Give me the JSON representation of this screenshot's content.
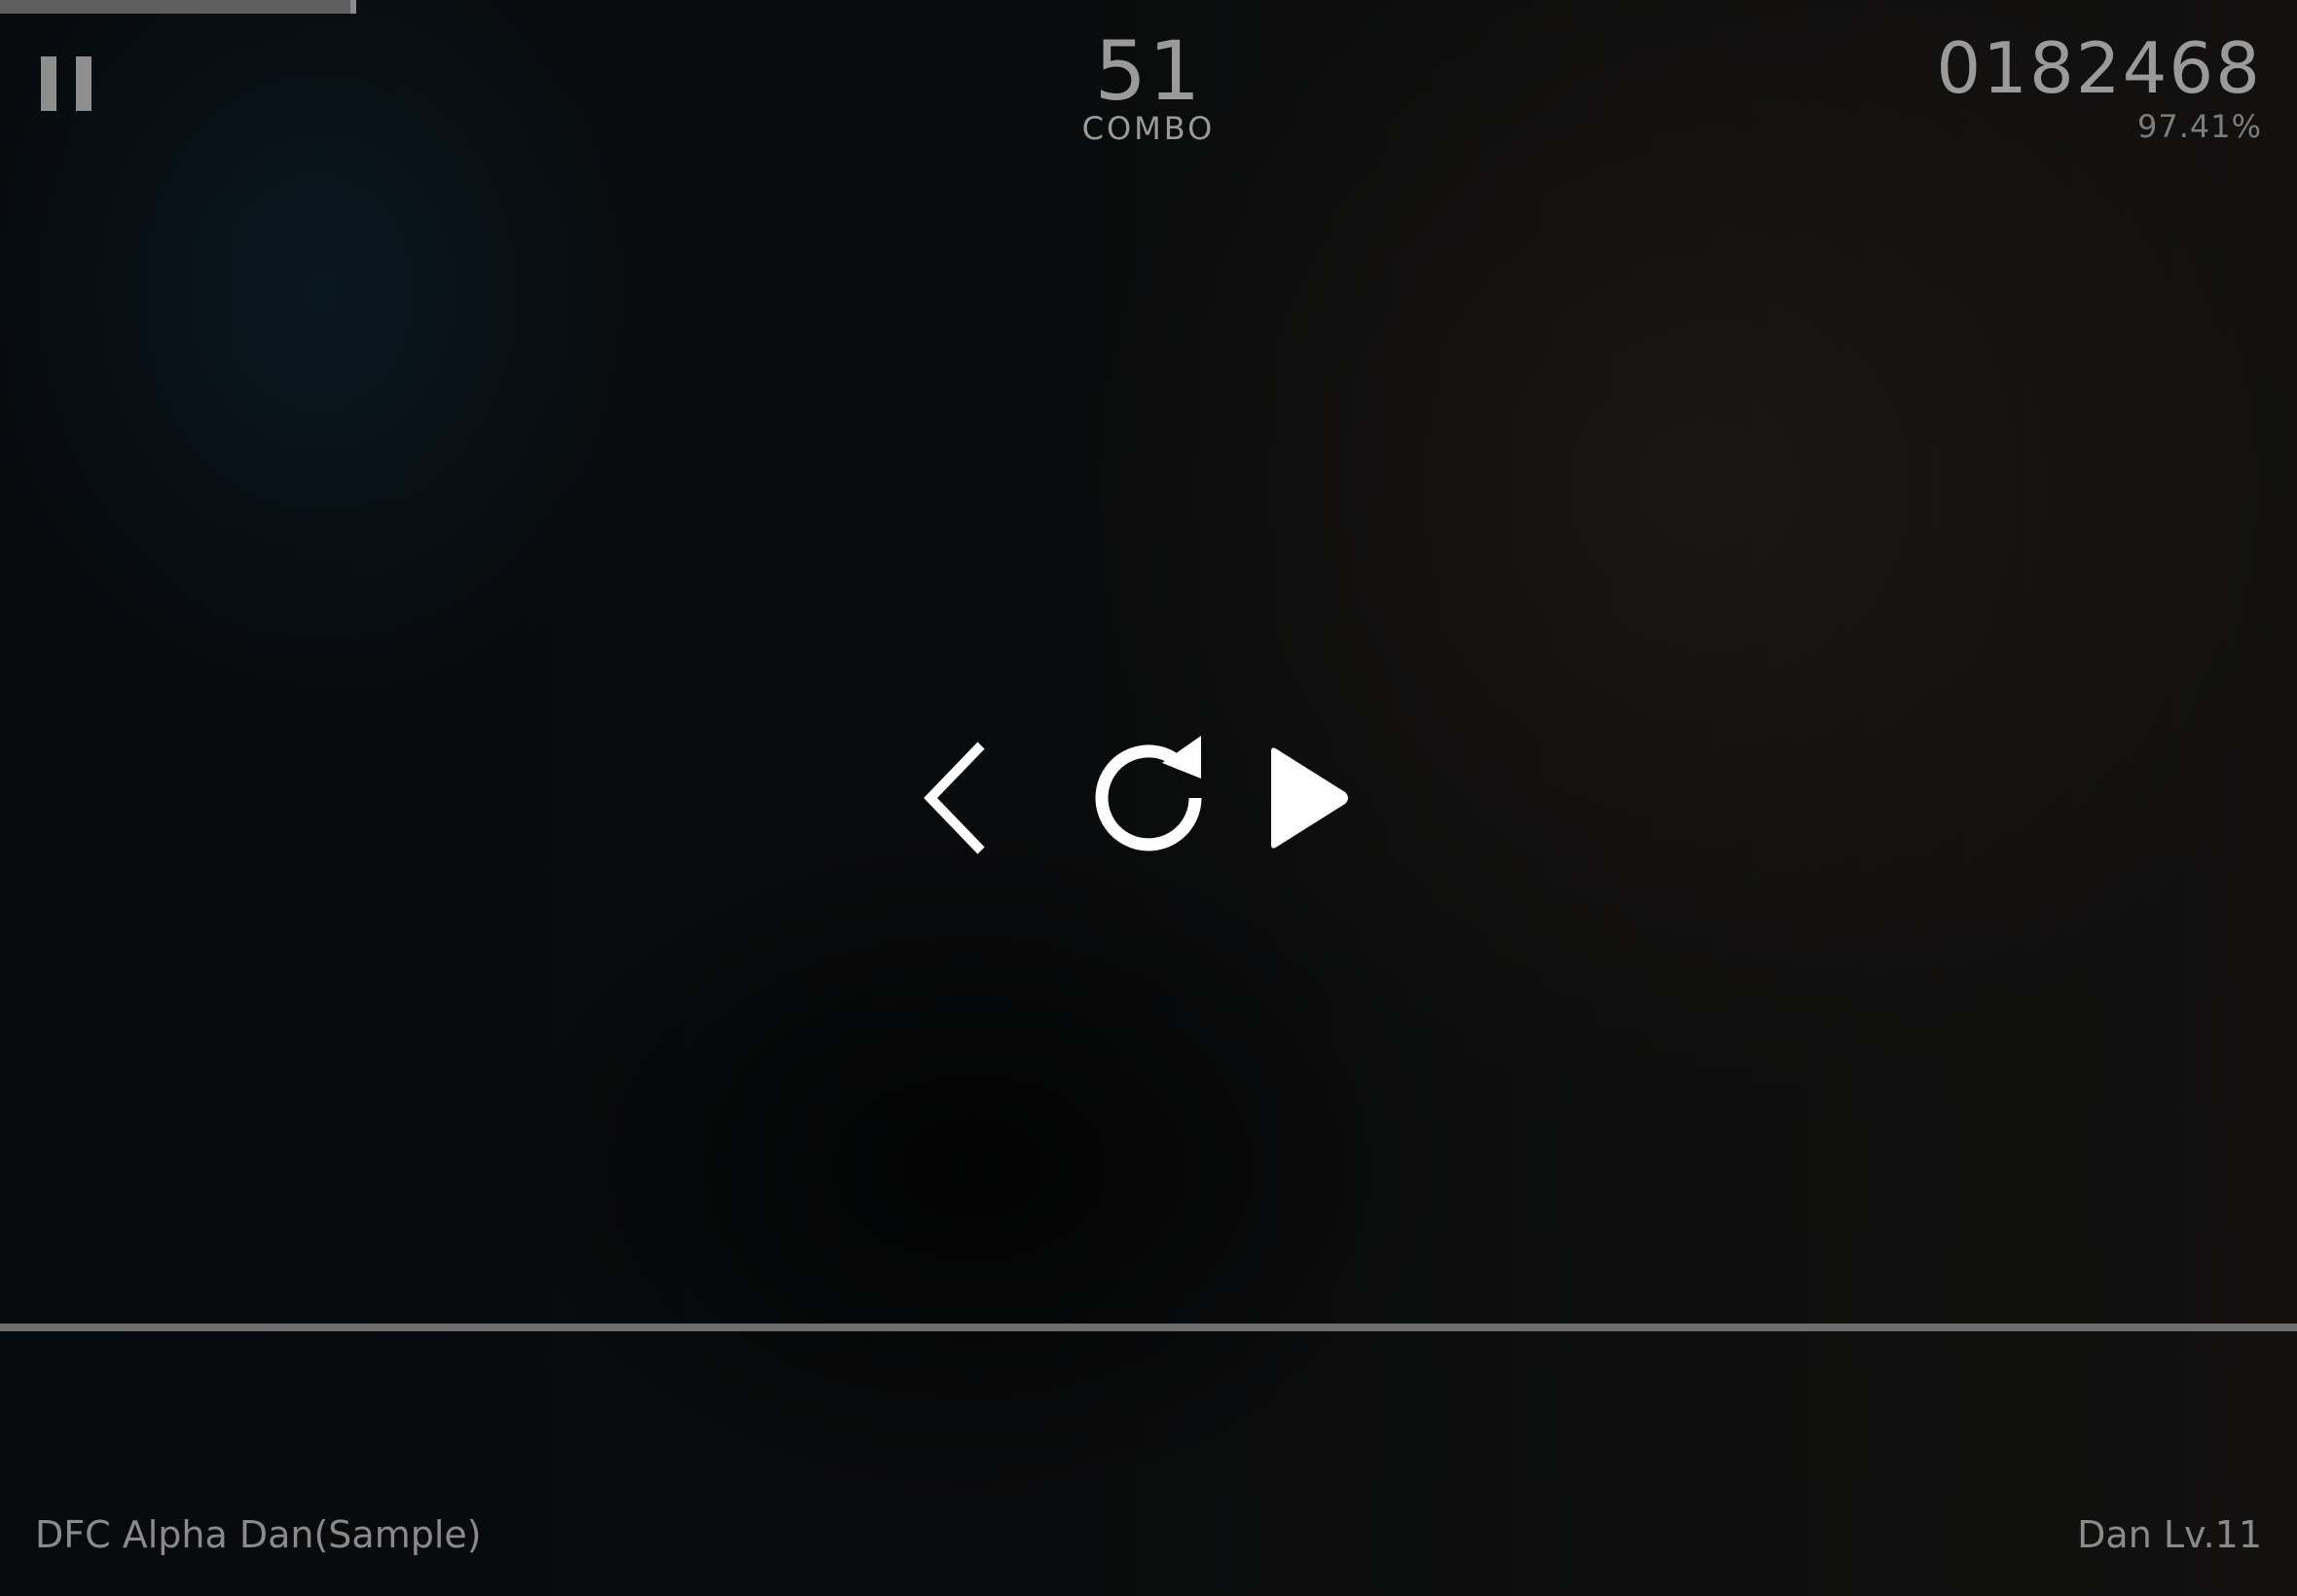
{
  "hud": {
    "progress": 0.155,
    "combo": {
      "value": "51",
      "label": "COMBO"
    },
    "score": {
      "value": "0182468",
      "accuracy": "97.41%"
    }
  },
  "pause_menu": {
    "buttons": [
      {
        "icon": "chevron-left-icon"
      },
      {
        "icon": "restart-icon"
      },
      {
        "icon": "play-icon"
      }
    ]
  },
  "footer": {
    "song_title": "DFC Alpha Dan(Sample)",
    "level": "Dan Lv.11"
  },
  "colors": {
    "hud_text": "#9a9a9a",
    "icon": "#ffffff",
    "judge_line": "#6e6e6e"
  }
}
